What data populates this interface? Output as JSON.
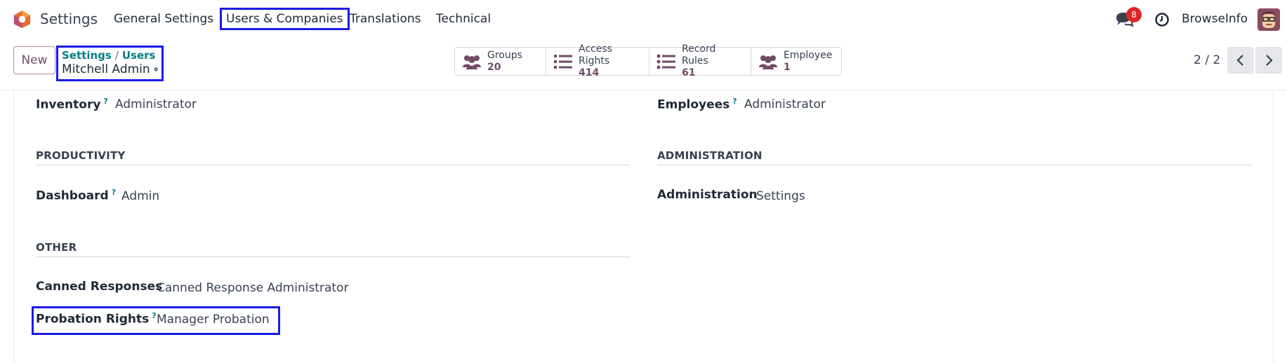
{
  "navbar": {
    "app_name": "Settings",
    "menu": [
      {
        "label": "General Settings"
      },
      {
        "label": "Users & Companies"
      },
      {
        "label": "Translations"
      },
      {
        "label": "Technical"
      }
    ],
    "message_count": "8",
    "company": "BrowseInfo",
    "icons": [
      "odoo-logo-icon",
      "chat-icon",
      "clock-icon",
      "user-avatar"
    ]
  },
  "control_panel": {
    "new_label": "New",
    "breadcrumb": [
      "Settings",
      "Users"
    ],
    "breadcrumb_separator": "/",
    "record_title": "Mitchell Admin",
    "smart_buttons": [
      {
        "label": "Groups",
        "value": "20",
        "icon": "users-icon"
      },
      {
        "label": "Access Rights",
        "value": "414",
        "icon": "list-icon"
      },
      {
        "label": "Record Rules",
        "value": "61",
        "icon": "list-icon"
      },
      {
        "label": "Employee",
        "value": "1",
        "icon": "users-icon"
      }
    ],
    "pager": "2 / 2"
  },
  "form": {
    "inventory_label": "Inventory",
    "inventory_value": "Administrator",
    "employees_label": "Employees",
    "employees_value": "Administrator",
    "productivity_title": "PRODUCTIVITY",
    "administration_title": "ADMINISTRATION",
    "dashboard_label": "Dashboard",
    "dashboard_value": "Admin",
    "administration_label": "Administration",
    "administration_value": "Settings",
    "other_title": "OTHER",
    "canned_label": "Canned Responses",
    "canned_value": "Canned Response Administrator",
    "probation_label": "Probation Rights",
    "probation_value": "Manager Probation",
    "help_mark": "?"
  },
  "colors": {
    "accent": "#714b67",
    "link": "#017e84",
    "highlight": "#1a1ae6",
    "badge": "#dc2626"
  }
}
